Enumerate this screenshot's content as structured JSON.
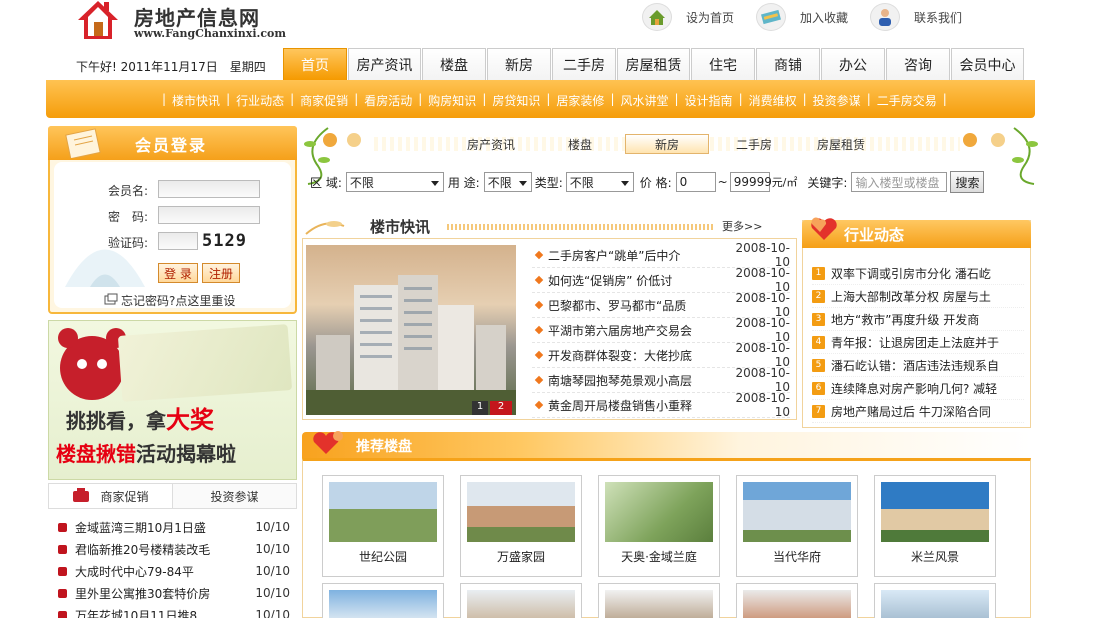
{
  "site": {
    "title": "房地产信息网",
    "url": "www.FangChanxinxi.com"
  },
  "top_links": [
    {
      "label": "设为首页",
      "icon": "home-icon"
    },
    {
      "label": "加入收藏",
      "icon": "bookmark-icon"
    },
    {
      "label": "联系我们",
      "icon": "contact-icon"
    }
  ],
  "date_text": "下午好! 2011年11月17日　星期四",
  "main_nav": [
    "首页",
    "房产资讯",
    "楼盘",
    "新房",
    "二手房",
    "房屋租赁",
    "住宅",
    "商铺",
    "办公",
    "咨询",
    "会员中心"
  ],
  "sub_nav": [
    "楼市快讯",
    "行业动态",
    "商家促销",
    "看房活动",
    "购房知识",
    "房贷知识",
    "居家装修",
    "风水讲堂",
    "设计指南",
    "消费维权",
    "投资参谋",
    "二手房交易"
  ],
  "login": {
    "title": "会员登录",
    "username_label": "会员名:",
    "password_label": "密　码:",
    "captcha_label": "验证码:",
    "captcha_value": "5129",
    "login_button": "登 录",
    "register_button": "注册",
    "forgot": "忘记密码?点这里重设"
  },
  "promo": {
    "line1_a": "挑挑看，拿",
    "line1_b": "大奖",
    "line2_a": "楼盘揪错",
    "line2_b": "活动揭幕啦"
  },
  "left_tabs": [
    "商家促销",
    "投资参谋"
  ],
  "left_list": [
    {
      "text": "金域蓝湾三期10月1日盛",
      "date": "10/10"
    },
    {
      "text": "君临新推20号楼精装改毛",
      "date": "10/10"
    },
    {
      "text": "大成时代中心79-84平",
      "date": "10/10"
    },
    {
      "text": "里外里公寓推30套特价房",
      "date": "10/10"
    },
    {
      "text": "万年花城10月11日推8",
      "date": "10/10"
    }
  ],
  "search_tabs": [
    "房产资讯",
    "楼盘",
    "新房",
    "二手房",
    "房屋租赁"
  ],
  "search": {
    "area_label": "区 域:",
    "area_value": "不限",
    "use_label": "用 途:",
    "use_value": "不限",
    "type_label": "类型:",
    "type_value": "不限",
    "price_label": "价 格:",
    "price_min": "0",
    "price_sep": "~",
    "price_max": "99999",
    "price_unit": "元/㎡",
    "keyword_label": "关键字:",
    "keyword_placeholder": "输入楼型或楼盘",
    "button": "搜索"
  },
  "news": {
    "title": "楼市快讯",
    "more": "更多>>",
    "pager": [
      "1",
      "2"
    ],
    "items": [
      {
        "text": "二手房客户“跳单”后中介",
        "date": "2008-10-10"
      },
      {
        "text": "如何选“促销房” 价低讨",
        "date": "2008-10-10"
      },
      {
        "text": "巴黎都市、罗马都市“品质",
        "date": "2008-10-10"
      },
      {
        "text": "平湖市第六届房地产交易会",
        "date": "2008-10-10"
      },
      {
        "text": "开发商群体裂变：大佬抄底",
        "date": "2008-10-10"
      },
      {
        "text": "南塘琴园抱琴苑景观小高层",
        "date": "2008-10-10"
      },
      {
        "text": "黄金周开局楼盘销售小重释",
        "date": "2008-10-10"
      }
    ]
  },
  "industry": {
    "title": "行业动态",
    "items": [
      "双率下调或引房市分化 潘石屹",
      "上海大部制改革分权 房屋与土",
      "地方“救市”再度升级 开发商",
      "青年报：让退房团走上法庭并于",
      "潘石屹认错：酒店违法违规系自",
      "连续降息对房产影响几何? 减轻",
      "房地产赌局过后 牛刀深陷合同"
    ]
  },
  "recommend": {
    "title": "推荐楼盘",
    "cards": [
      "世纪公园",
      "万盛家园",
      "天奥·金域兰庭",
      "当代华府",
      "米兰风景"
    ]
  },
  "colors": {
    "accent": "#f59d0a",
    "accent_light": "#ffc352",
    "red": "#e60012"
  }
}
